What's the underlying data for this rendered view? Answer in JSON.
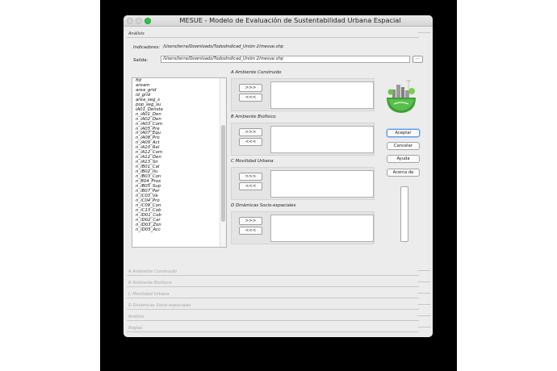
{
  "window": {
    "title": "MESUE - Modelo de Evaluación de Sustentabilidad Urbana Espacial"
  },
  "analysis": {
    "section_label": "Análisis",
    "indicadores_label": "Indicadores:",
    "indicadores_value": "/Users/terra/Downloads/TodosIndicad_Unión 2/mesue.shp",
    "salida_label": "Salida:",
    "salida_value": "/Users/terra/Downloads/TodosIndicad_Unión 2/mesue.shp",
    "browse_label": "..."
  },
  "fields": [
    "fid",
    "aream",
    "area_grid",
    "id_grid",
    "area_seg_s",
    "pop_seg_su",
    "iA01_Densta",
    "n_iA01_Den",
    "n_iA02_Den",
    "n_iA03_Com",
    "n_iA05_Pre",
    "n_iA07_Equ",
    "n_iA08_Pro",
    "n_iA09_Act",
    "n_iA10_Rel",
    "n_iA12_Com",
    "n_iA12_Den",
    "n_iA13_Sn",
    "n_iB01_Cal",
    "n_iB02_Ilu",
    "n_iB03_Con",
    "n_B04_Prox",
    "n_iB05_Sup",
    "n_iB07_Per",
    "n_iC03_Va",
    "n_iC04_Pro",
    "n_iC09_Con",
    "n_iC13_Cob",
    "n_iD01_Cob",
    "n_iD02_Car",
    "n_iD03_Zon",
    "n_iD05_Acc"
  ],
  "groups": [
    {
      "label": "A Ambiente Construido",
      "add": ">>>",
      "remove": "<<<"
    },
    {
      "label": "B Ambiente Biofísico",
      "add": ">>>",
      "remove": "<<<"
    },
    {
      "label": "C Movilidad Urbana",
      "add": ">>>",
      "remove": "<<<"
    },
    {
      "label": "D Dinámicas Socio-espaciales",
      "add": ">>>",
      "remove": "<<<"
    }
  ],
  "buttons": {
    "accept": "Aceptar",
    "cancel": "Cancelar",
    "help": "Ayuda",
    "about": "Acerca de"
  },
  "collapsed_sections": [
    "A Ambiente Construido",
    "B Ambiente Biofísico",
    "C Movilidad Urbana",
    "D Dinámicas Socio-espaciales",
    "Análisis",
    "Reglas"
  ],
  "colors": {
    "accept_focus": "#5b9ae6",
    "logo_green": "#4caf50",
    "zoom_button": "#2ec443"
  }
}
